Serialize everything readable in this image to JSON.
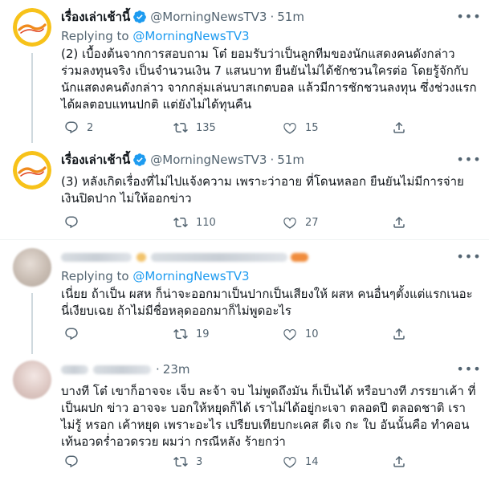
{
  "tweets": [
    {
      "name": "เรื่องเล่าเช้านี้",
      "handle": "@MorningNewsTV3",
      "separator": "·",
      "time": "51m",
      "reply_prefix": "Replying to",
      "reply_to": "@MorningNewsTV3",
      "text": "(2) เบื้องต้นจากการสอบถาม โต๋ ยอมรับว่าเป็นลูกทีมของนักแสดงคนดังกล่าว ร่วมลงทุนจริง เป็นจำนวนเงิน 7 แสนบาท ยืนยันไม่ได้ชักชวนใครต่อ โดยรู้จักกับนักแสดงคนดังกล่าว จากกลุ่มเล่นบาสเกตบอล แล้วมีการชักชวนลงทุน ซึ่งช่วงแรกได้ผลตอบแทนปกติ แต่ยังไม่ได้ทุนคืน",
      "replies": "2",
      "retweets": "135",
      "likes": "15"
    },
    {
      "name": "เรื่องเล่าเช้านี้",
      "handle": "@MorningNewsTV3",
      "separator": "·",
      "time": "51m",
      "text": "(3) หลังเกิดเรื่องที่ไม่ไปแจ้งความ เพราะว่าอาย ที่โดนหลอก ยืนยันไม่มีการจ่ายเงินปิดปาก ไม่ให้ออกข่าว",
      "replies": "",
      "retweets": "110",
      "likes": "27"
    },
    {
      "reply_prefix": "Replying to",
      "reply_to": "@MorningNewsTV3",
      "text": "เนี่ยย ถ้าเป็น ผสห ก็น่าจะออกมาเป็นปากเป็นเสียงให้ ผสห คนอื่นๆตั้งแต่แรกเนอะ นี่เงียบเฉย ถ้าไม่มีชื่อหลุดออกมาก็ไม่พูดอะไร",
      "replies": "",
      "retweets": "19",
      "likes": "10"
    },
    {
      "separator": "·",
      "time": "23m",
      "text": "บางที โต๋ เขาก็อาจจะ เจ็บ ละจ้า จบ ไม่พูดถึงมัน ก็เป็นได้ หรือบางที ภรรยาเค้า ที่เป็นผปก ข่าว อาจจะ บอกให้หยุดก็ได้ เราไม่ได้อยู่กะเจา ตลอดปี ตลอดชาติ เราไม่รู้ หรอก เค้าหยุด เพราะอะไร เปรียบเทียบกะเคส ดีเจ กะ ใบ อันนั้นคือ ทำคอนเท้นอวดร่ำอวดรวย ผมว่า กรณีหลัง ร้ายกว่า",
      "replies": "",
      "retweets": "3",
      "likes": "14"
    }
  ],
  "colors": {
    "text": "#0f1419",
    "secondary": "#536471",
    "link": "#1d9bf0",
    "verified": "#1d9bf0",
    "thread_line": "#cfd9de",
    "divider": "#eff3f4"
  },
  "icons": [
    "more-icon",
    "verified-badge-icon",
    "reply-icon",
    "retweet-icon",
    "like-icon",
    "share-icon"
  ]
}
